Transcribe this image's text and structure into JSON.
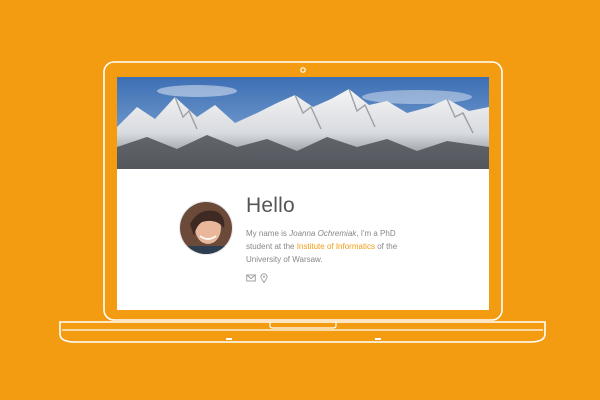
{
  "colors": {
    "background": "#f39c12",
    "outline": "#ffffff",
    "link": "#f39c12",
    "heading": "#555555",
    "body_text": "#888888"
  },
  "banner": {
    "image": "snowy-mountain-range-photo"
  },
  "profile": {
    "avatar": "profile-photo",
    "greeting": "Hello",
    "intro_prefix": "My name is ",
    "name": "Joanna Ochremiak",
    "intro_middle": ", I'm a PhD student at the ",
    "institute_link": "Institute of Informatics",
    "intro_suffix": " of the University of Warsaw."
  },
  "contact": {
    "icons": [
      "envelope-icon",
      "location-pin-icon"
    ]
  }
}
